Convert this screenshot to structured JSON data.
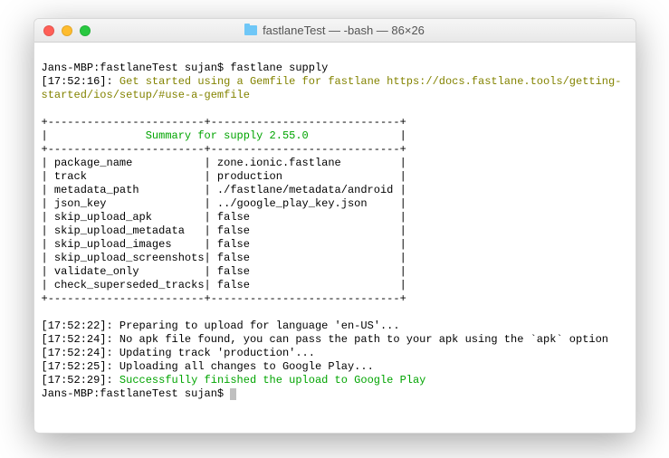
{
  "window": {
    "title": "fastlaneTest — -bash — 86×26"
  },
  "prompt1": "Jans-MBP:fastlaneTest sujan$ ",
  "command": "fastlane supply",
  "ts_getstarted": "[17:52:16]: ",
  "getstarted": "Get started using a Gemfile for fastlane https://docs.fastlane.tools/getting-started/ios/setup/#use-a-gemfile",
  "table": {
    "border": "+------------------------+-----------------------------+",
    "header_pipe_l": "|               ",
    "header_text": "Summary for supply 2.55.0",
    "header_pipe_r": "              |",
    "rows": [
      {
        "key": "package_name",
        "val": "zone.ionic.fastlane"
      },
      {
        "key": "track",
        "val": "production"
      },
      {
        "key": "metadata_path",
        "val": "./fastlane/metadata/android"
      },
      {
        "key": "json_key",
        "val": "../google_play_key.json"
      },
      {
        "key": "skip_upload_apk",
        "val": "false"
      },
      {
        "key": "skip_upload_metadata",
        "val": "false"
      },
      {
        "key": "skip_upload_images",
        "val": "false"
      },
      {
        "key": "skip_upload_screenshots",
        "val": "false"
      },
      {
        "key": "validate_only",
        "val": "false"
      },
      {
        "key": "check_superseded_tracks",
        "val": "false"
      }
    ]
  },
  "logs": [
    {
      "ts": "[17:52:22]: ",
      "msg": "Preparing to upload for language 'en-US'...",
      "color": ""
    },
    {
      "ts": "[17:52:24]: ",
      "msg": "No apk file found, you can pass the path to your apk using the `apk` option",
      "color": ""
    },
    {
      "ts": "[17:52:24]: ",
      "msg": "Updating track 'production'...",
      "color": ""
    },
    {
      "ts": "[17:52:25]: ",
      "msg": "Uploading all changes to Google Play...",
      "color": ""
    },
    {
      "ts": "[17:52:29]: ",
      "msg": "Successfully finished the upload to Google Play",
      "color": "green"
    }
  ],
  "prompt2": "Jans-MBP:fastlaneTest sujan$ "
}
